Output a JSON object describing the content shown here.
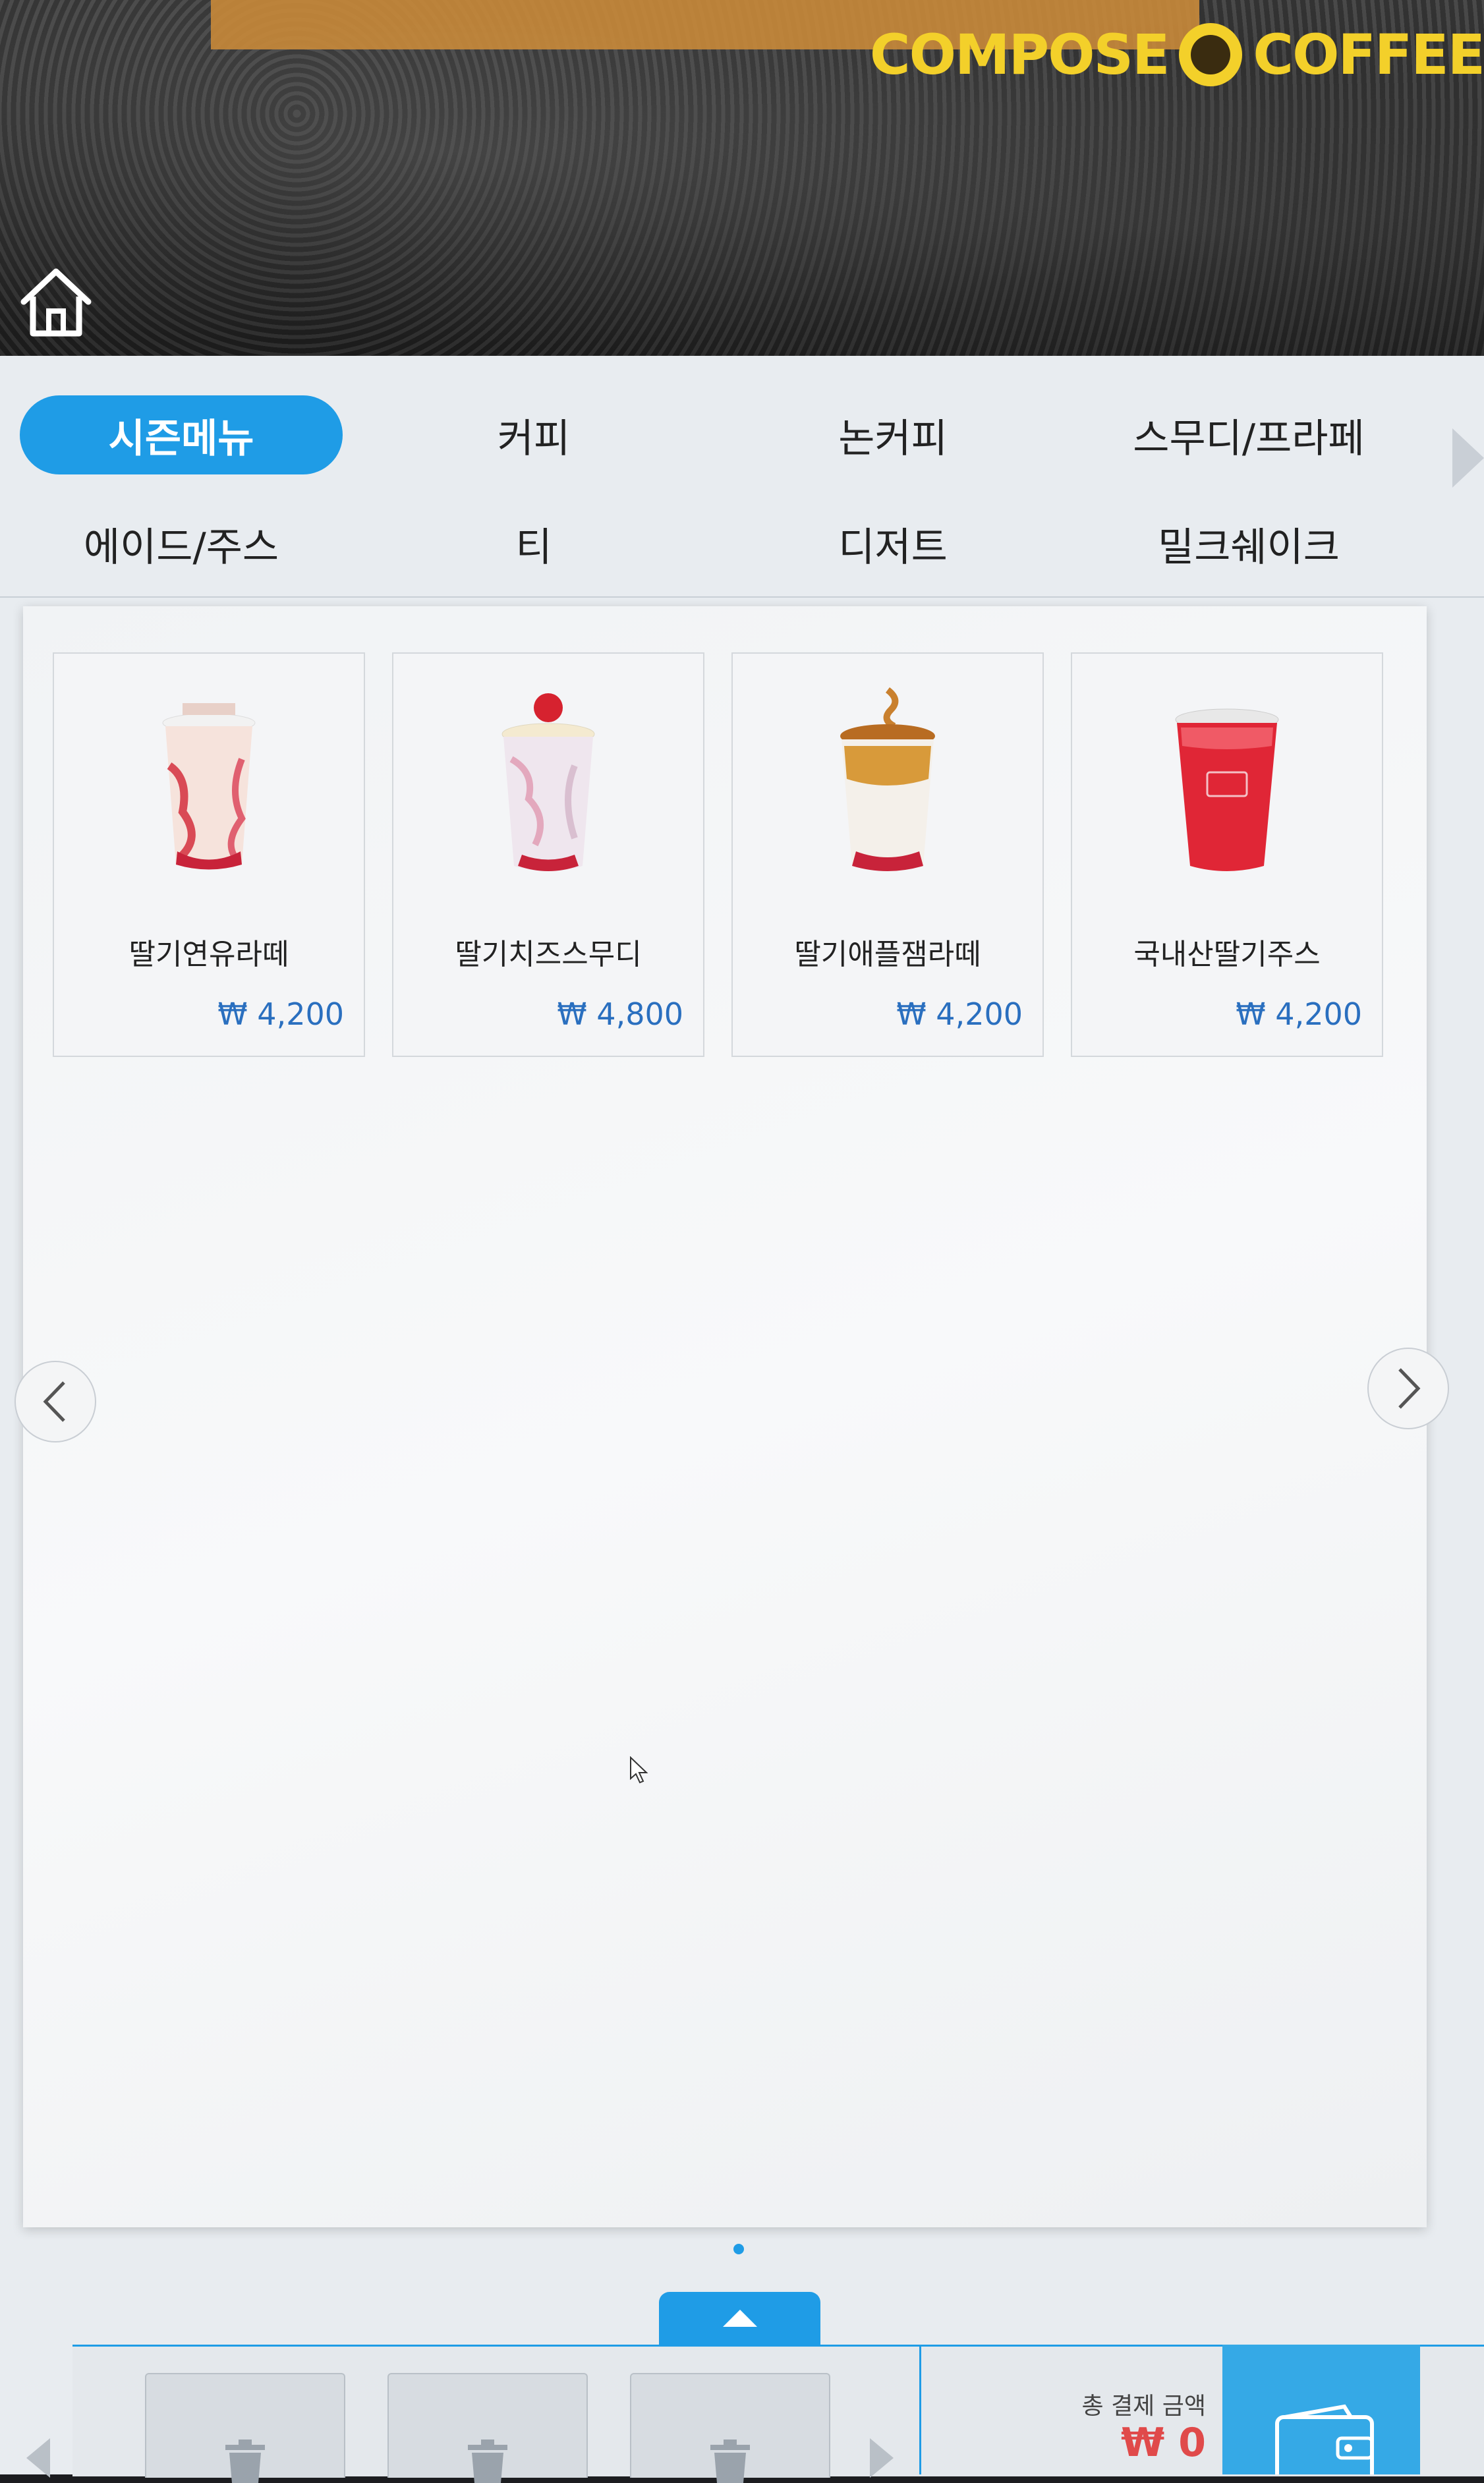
{
  "brand": {
    "logo_text_left": "COMPOSE",
    "logo_text_right": "COFFEE",
    "logo_color": "#f3d02a"
  },
  "accent_color": "#1f9ce6",
  "home": {
    "icon": "home-icon"
  },
  "categories": {
    "row1": [
      "시즌메뉴",
      "커피",
      "논커피",
      "스무디/프라페"
    ],
    "row2": [
      "에이드/주스",
      "티",
      "디저트",
      "밀크쉐이크"
    ],
    "active": "시즌메뉴"
  },
  "menu": {
    "items": [
      {
        "name": "딸기연유라떼",
        "price": "₩ 4,200"
      },
      {
        "name": "딸기치즈스무디",
        "price": "₩ 4,800"
      },
      {
        "name": "딸기애플잼라떼",
        "price": "₩ 4,200"
      },
      {
        "name": "국내산딸기주스",
        "price": "₩ 4,200"
      }
    ],
    "page_current": 1,
    "page_total": 1
  },
  "cart": {
    "total_label": "총 결제 금액",
    "total_value": "₩ 0",
    "slots": 3,
    "pay_icon": "wallet-icon"
  }
}
